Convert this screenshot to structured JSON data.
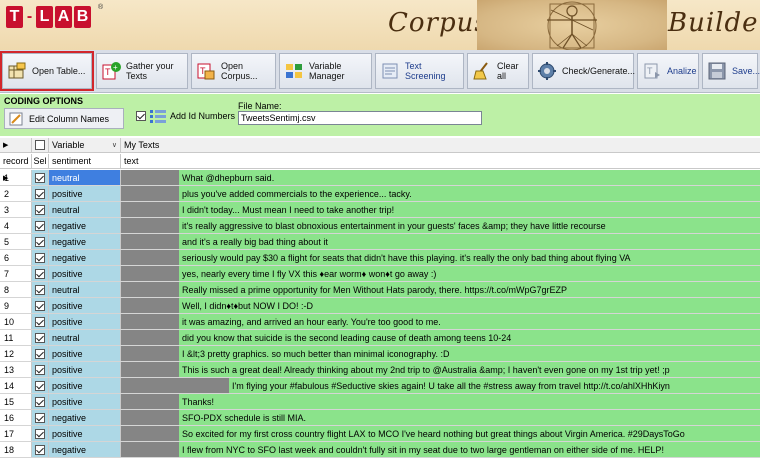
{
  "banner": {
    "logo_letters": [
      "T",
      "-",
      "L",
      "A",
      "B"
    ],
    "logo_mark": "®",
    "title_left": "Corpus",
    "title_right": "Builder"
  },
  "toolbar": {
    "buttons": [
      {
        "label": "Open Table...",
        "icon": "table-open-icon",
        "selected": true
      },
      {
        "label": "Gather your Texts",
        "icon": "gather-texts-icon"
      },
      {
        "label": "Open Corpus...",
        "icon": "open-corpus-icon"
      },
      {
        "label": "Variable Manager",
        "icon": "variable-manager-icon"
      },
      {
        "label": "Text Screening",
        "icon": "text-screening-icon"
      },
      {
        "label": "Clear all",
        "icon": "broom-icon"
      },
      {
        "label": "Check/Generate...",
        "icon": "gear-icon"
      },
      {
        "label": "Analize",
        "icon": "analyze-icon"
      },
      {
        "label": "Save...",
        "icon": "save-disk-icon"
      }
    ]
  },
  "options": {
    "heading": "CODING OPTIONS",
    "edit_columns_label": "Edit Column Names",
    "add_id_label": "Add Id Numbers",
    "add_id_checked": true,
    "file_name_label": "File Name:",
    "file_name_value": "TweetsSentimj.csv"
  },
  "grid": {
    "header_top": {
      "variable": "Variable",
      "my_texts": "My Texts"
    },
    "header_cols": {
      "record": "record",
      "sel": "Sel",
      "sentiment": "sentiment",
      "text": "text"
    },
    "rows": [
      {
        "num": "1",
        "sentiment": "neutral",
        "text": "What @dhepburn said."
      },
      {
        "num": "2",
        "sentiment": "positive",
        "text": "plus you've added commercials to the experience... tacky."
      },
      {
        "num": "3",
        "sentiment": "neutral",
        "text": "I didn't today... Must mean I need to take another trip!"
      },
      {
        "num": "4",
        "sentiment": "negative",
        "text": "it's really aggressive to blast obnoxious entertainment in your guests' faces &amp; they have little recourse"
      },
      {
        "num": "5",
        "sentiment": "negative",
        "text": "and it's a really big bad thing about it"
      },
      {
        "num": "6",
        "sentiment": "negative",
        "text": "seriously would pay $30 a flight for seats that didn't have this playing. it's really the only bad thing about flying VA"
      },
      {
        "num": "7",
        "sentiment": "positive",
        "text": "yes, nearly every time I fly VX this ♦ear worm♦ won♦t go away :)"
      },
      {
        "num": "8",
        "sentiment": "neutral",
        "text": "Really missed a prime opportunity for Men Without Hats parody, there. https://t.co/mWpG7grEZP"
      },
      {
        "num": "9",
        "sentiment": "positive",
        "text": "Well, I didn♦t♦but NOW I DO! :-D"
      },
      {
        "num": "10",
        "sentiment": "positive",
        "text": "it was amazing, and arrived an hour early. You're too good to me."
      },
      {
        "num": "11",
        "sentiment": "neutral",
        "text": "did you know that suicide is the second leading cause of death among teens 10-24"
      },
      {
        "num": "12",
        "sentiment": "positive",
        "text": "I &lt;3 pretty graphics. so much better than minimal iconography. :D"
      },
      {
        "num": "13",
        "sentiment": "positive",
        "text": "This is such a great deal! Already thinking about my 2nd trip to @Australia &amp; I haven't even gone on my 1st trip yet! ;p"
      },
      {
        "num": "14",
        "sentiment": "positive",
        "text": "I'm flying your #fabulous #Seductive skies again! U take all the #stress away from travel http://t.co/ahlXHhKiyn",
        "wide": true
      },
      {
        "num": "15",
        "sentiment": "positive",
        "text": "Thanks!"
      },
      {
        "num": "16",
        "sentiment": "negative",
        "text": "SFO-PDX schedule is still MIA."
      },
      {
        "num": "17",
        "sentiment": "positive",
        "text": "So excited for my first cross country flight LAX to MCO I've heard nothing but great things about Virgin America. #29DaysToGo"
      },
      {
        "num": "18",
        "sentiment": "negative",
        "text": "I flew from NYC to SFO last week and couldn't fully sit in my seat due to two large gentleman on either side of me. HELP!"
      }
    ]
  },
  "colors": {
    "accent_selection": "#d2262c",
    "sentiment_bg": "#add8e6",
    "text_bg": "#8be38b",
    "options_bg": "#bdf0a6"
  }
}
